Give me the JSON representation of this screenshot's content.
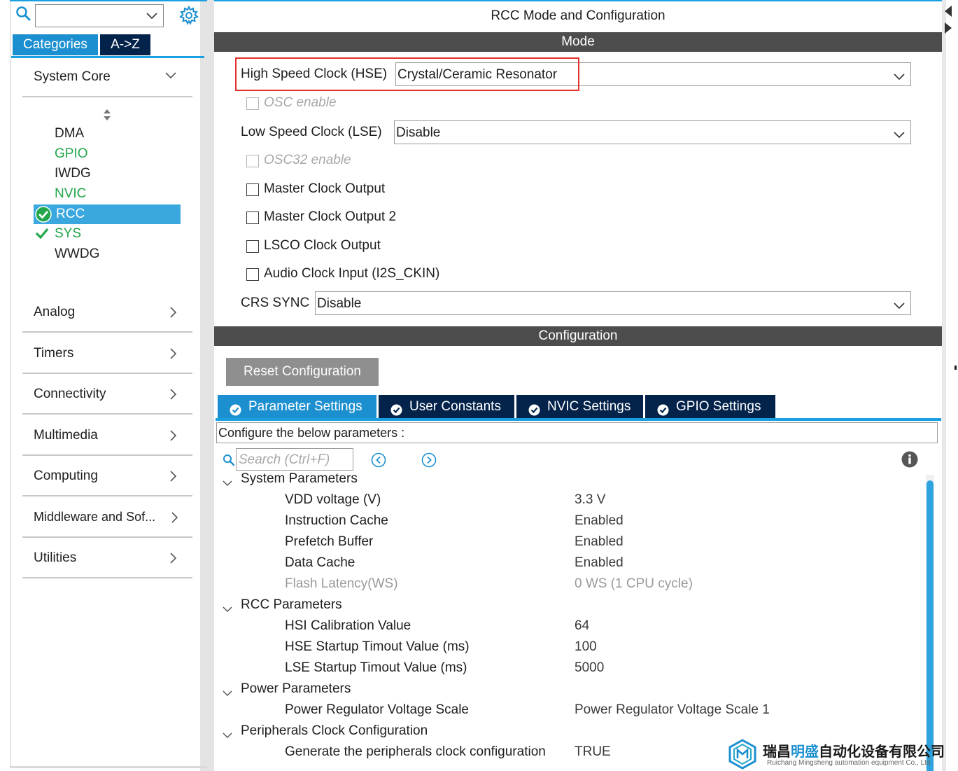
{
  "sidebar": {
    "search_value": "",
    "tabs": {
      "categories": "Categories",
      "az": "A->Z"
    },
    "system_core": {
      "label": "System Core",
      "items": [
        "DMA",
        "GPIO",
        "IWDG",
        "NVIC",
        "RCC",
        "SYS",
        "WWDG"
      ]
    },
    "categories": [
      "Analog",
      "Timers",
      "Connectivity",
      "Multimedia",
      "Computing",
      "Middleware and Sof...",
      "Utilities"
    ]
  },
  "panel": {
    "title": "RCC Mode and Configuration",
    "mode_header": "Mode",
    "hse": {
      "label": "High Speed Clock (HSE)",
      "value": "Crystal/Ceramic Resonator"
    },
    "osc_enable": "OSC enable",
    "lse": {
      "label": "Low Speed Clock (LSE)",
      "value": "Disable"
    },
    "osc32_enable": "OSC32 enable",
    "checkboxes": [
      "Master Clock Output",
      "Master Clock Output 2",
      "LSCO Clock Output",
      "Audio Clock Input (I2S_CKIN)"
    ],
    "crs": {
      "label": "CRS SYNC",
      "value": "Disable"
    },
    "config_header": "Configuration",
    "reset_label": "Reset Configuration",
    "tabs": [
      "Parameter Settings",
      "User Constants",
      "NVIC Settings",
      "GPIO Settings"
    ],
    "description": "Configure the below parameters :",
    "search_placeholder": "Search (Ctrl+F)"
  },
  "params": {
    "system": {
      "title": "System Parameters",
      "rows": [
        {
          "name": "VDD voltage (V)",
          "value": "3.3 V"
        },
        {
          "name": "Instruction Cache",
          "value": "Enabled"
        },
        {
          "name": "Prefetch Buffer",
          "value": "Enabled"
        },
        {
          "name": "Data Cache",
          "value": "Enabled"
        },
        {
          "name": "Flash Latency(WS)",
          "value": "0 WS (1 CPU cycle)"
        }
      ]
    },
    "rcc": {
      "title": "RCC Parameters",
      "rows": [
        {
          "name": "HSI Calibration Value",
          "value": "64"
        },
        {
          "name": "HSE Startup Timout Value (ms)",
          "value": "100"
        },
        {
          "name": "LSE Startup Timout Value (ms)",
          "value": "5000"
        }
      ]
    },
    "power": {
      "title": "Power Parameters",
      "rows": [
        {
          "name": "Power Regulator Voltage Scale",
          "value": "Power Regulator Voltage Scale 1"
        }
      ]
    },
    "periph": {
      "title": "Peripherals Clock Configuration",
      "rows": [
        {
          "name": "Generate the peripherals clock configuration",
          "value": "TRUE"
        }
      ]
    }
  },
  "watermark": {
    "text_a": "瑞昌",
    "text_b": "明盛",
    "text_c": "自动化设备有限公司",
    "sub": "Ruichang Mingsheng automation equipment Co., Ltd"
  },
  "colors": {
    "accent": "#1c8fd0",
    "tab_dark": "#03234b",
    "header_bar": "#4d4d4d",
    "green": "#21a64a",
    "highlight": "#e5312c"
  }
}
